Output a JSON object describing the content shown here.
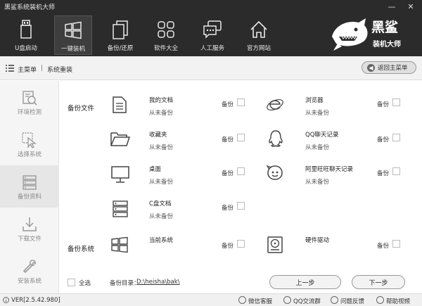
{
  "window": {
    "title": "黑鲨系统装机大师",
    "minimize": "—",
    "close": "✕"
  },
  "nav": {
    "items": [
      {
        "label": "U盘启动",
        "icon": "usb-drive-icon"
      },
      {
        "label": "一键装机",
        "icon": "windows-icon",
        "active": true
      },
      {
        "label": "备份/还原",
        "icon": "backup-restore-icon"
      },
      {
        "label": "软件大全",
        "icon": "apps-grid-icon"
      },
      {
        "label": "人工服务",
        "icon": "chat-icon"
      },
      {
        "label": "官方网站",
        "icon": "home-icon"
      }
    ]
  },
  "logo": {
    "line1": "黑鲨",
    "line2": "装机大师"
  },
  "breadcrumb": {
    "root": "主菜单",
    "separator": "|",
    "current": "系统重装",
    "back_label": "返回主菜单"
  },
  "sidebar": {
    "items": [
      {
        "label": "环境检测",
        "icon": "environment-check-icon"
      },
      {
        "label": "选择系统",
        "icon": "cursor-select-icon"
      },
      {
        "label": "备份资料",
        "icon": "backup-data-icon",
        "active": true
      },
      {
        "label": "下载文件",
        "icon": "download-icon"
      },
      {
        "label": "安装系统",
        "icon": "wrench-icon"
      }
    ]
  },
  "content": {
    "files_section": "备份文件",
    "system_section": "备份系统",
    "backup_label": "备份",
    "never_backed": "从未备份",
    "items": {
      "documents": "我的文档",
      "favorites": "收藏夹",
      "desktop": "桌面",
      "c_docs": "C盘文档",
      "browser": "浏览器",
      "qq": "QQ聊天记录",
      "aliwangwang": "阿里旺旺聊天记录",
      "current_system": "当前系统",
      "hardware_driver": "硬件驱动"
    },
    "select_all": "全选",
    "backup_dir_label": "备份目录：",
    "backup_dir": "D:\\heisha\\bak\\",
    "prev_button": "上一步",
    "next_button": "下一步"
  },
  "footer": {
    "version": "VER[2.5.42.980]",
    "wechat": "微信客服",
    "qq_group": "QQ交流群",
    "feedback": "问题反馈",
    "help_video": "帮助视频"
  },
  "colors": {
    "dark_bar": "#2b2b2b",
    "sidebar_bg": "#f5f5f5",
    "active_nav": "#3e3e3e"
  }
}
